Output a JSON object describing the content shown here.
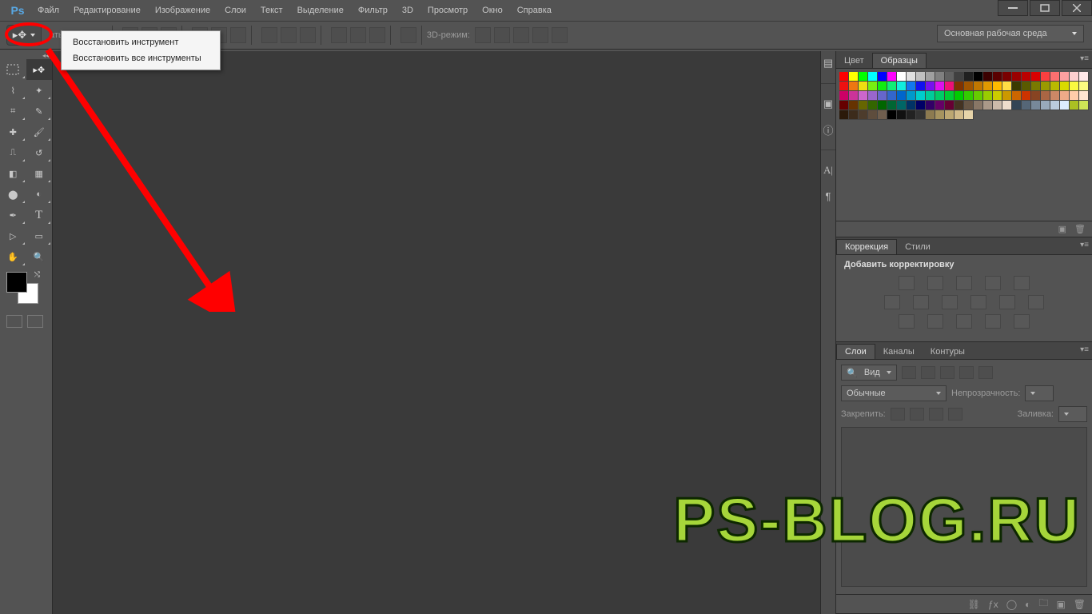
{
  "app": {
    "logo": "Ps"
  },
  "menu": [
    "Файл",
    "Редактирование",
    "Изображение",
    "Слои",
    "Текст",
    "Выделение",
    "Фильтр",
    "3D",
    "Просмотр",
    "Окно",
    "Справка"
  ],
  "options": {
    "truncated_label": "ать упр. элем.",
    "mode_label": "3D-режим:",
    "workspace": "Основная рабочая среда"
  },
  "context_menu": [
    "Восстановить инструмент",
    "Восстановить все инструменты"
  ],
  "panels": {
    "color": {
      "tabs": [
        "Цвет",
        "Образцы"
      ],
      "active": 1
    },
    "adjustments": {
      "tabs": [
        "Коррекция",
        "Стили"
      ],
      "active": 0,
      "title": "Добавить корректировку"
    },
    "layers": {
      "tabs": [
        "Слои",
        "Каналы",
        "Контуры"
      ],
      "active": 0,
      "filter": "Вид",
      "blend": "Обычные",
      "opacity_label": "Непрозрачность:",
      "lock_label": "Закрепить:",
      "fill_label": "Заливка:"
    }
  },
  "swatch_colors": [
    "#ff0000",
    "#ffff00",
    "#00ff00",
    "#00ffff",
    "#0000ff",
    "#ff00ff",
    "#ffffff",
    "#e0e0e0",
    "#c0c0c0",
    "#a0a0a0",
    "#808080",
    "#606060",
    "#404040",
    "#202020",
    "#000000",
    "#3b0000",
    "#5a0000",
    "#7a0000",
    "#9a0000",
    "#ba0000",
    "#da0000",
    "#fa4040",
    "#fb7070",
    "#fca0a0",
    "#fdd0d0",
    "#ffe8e8",
    "#ee1111",
    "#ee7711",
    "#eedd11",
    "#77ee11",
    "#11ee11",
    "#11ee77",
    "#11eedd",
    "#1177ee",
    "#1111ee",
    "#7711ee",
    "#dd11ee",
    "#ee1177",
    "#803300",
    "#a05500",
    "#c07700",
    "#e09900",
    "#ffbb00",
    "#ffdd44",
    "#3b3b00",
    "#5a5a00",
    "#7a7a00",
    "#9a9a00",
    "#baba00",
    "#dada00",
    "#fafa40",
    "#fbfb80",
    "#cc0066",
    "#cc3399",
    "#cc66cc",
    "#9966cc",
    "#6666cc",
    "#3366cc",
    "#0066cc",
    "#0099cc",
    "#00cccc",
    "#00cc99",
    "#00cc66",
    "#00cc33",
    "#00cc00",
    "#33cc00",
    "#66cc00",
    "#99cc00",
    "#cccc00",
    "#cc9900",
    "#cc6600",
    "#cc3300",
    "#884422",
    "#aa6644",
    "#cc8866",
    "#eeaa88",
    "#ffccaa",
    "#ffe5d0",
    "#660000",
    "#663300",
    "#666600",
    "#336600",
    "#006600",
    "#006633",
    "#006666",
    "#003366",
    "#000066",
    "#330066",
    "#660066",
    "#660033",
    "#443322",
    "#665544",
    "#887766",
    "#aa9988",
    "#ccbbaa",
    "#eeddcc",
    "#334455",
    "#556677",
    "#778899",
    "#99aabb",
    "#bbccdd",
    "#ddeeff",
    "#abc123",
    "#cde456",
    "#2b1a0a",
    "#3c2b1b",
    "#4d3c2c",
    "#5e4d3d",
    "#6f5e4e",
    "#000000",
    "#111111",
    "#222222",
    "#333333",
    "#8c7a50",
    "#a6935f",
    "#bda772",
    "#d2bb8a",
    "#e7d4a9"
  ],
  "watermark": "PS-BLOG.RU"
}
